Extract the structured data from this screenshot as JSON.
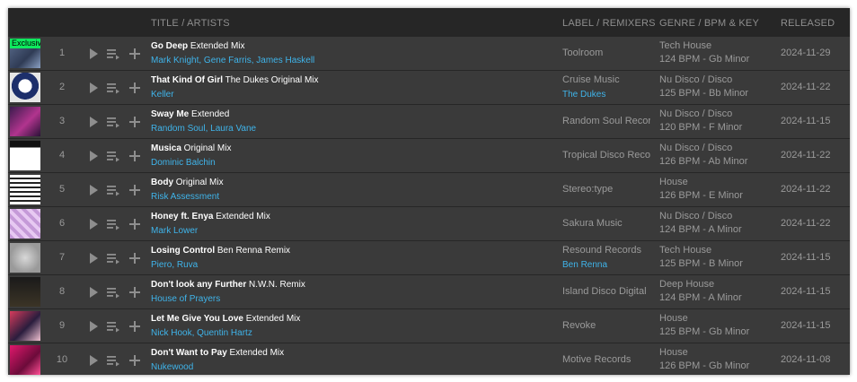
{
  "columns": {
    "title_artists": "TITLE / ARTISTS",
    "label_remixers": "LABEL / REMIXERS",
    "genre_bpm_key": "GENRE / BPM & KEY",
    "released": "RELEASED"
  },
  "badge_exclusive": "Exclusive",
  "icons": [
    "play-icon",
    "add-to-queue-icon",
    "plus-icon"
  ],
  "colors": {
    "accent_blue": "#3fb4ea",
    "exclusive_green": "#0eea5e",
    "row_bg": "#3a3a3a",
    "panel_bg": "#262626"
  },
  "tracks": [
    {
      "num": "1",
      "title": "Go Deep",
      "mix": " Extended Mix",
      "artists": "Mark Knight, Gene Farris, James Haskell",
      "label": "Toolroom",
      "remixers": "",
      "genre": "Tech House",
      "bpm_key": "124 BPM - Gb Minor",
      "released": "2024-11-29",
      "exclusive": true
    },
    {
      "num": "2",
      "title": "That Kind Of Girl",
      "mix": " The Dukes Original Mix",
      "artists": "Keller",
      "label": "Cruise Music",
      "remixers": "The Dukes",
      "genre": "Nu Disco / Disco",
      "bpm_key": "125 BPM - Bb Minor",
      "released": "2024-11-22"
    },
    {
      "num": "3",
      "title": "Sway Me",
      "mix": " Extended",
      "artists": "Random Soul, Laura Vane",
      "label": "Random Soul Recor",
      "remixers": "",
      "genre": "Nu Disco / Disco",
      "bpm_key": "120 BPM - F Minor",
      "released": "2024-11-15"
    },
    {
      "num": "4",
      "title": "Musica",
      "mix": " Original Mix",
      "artists": "Dominic Balchin",
      "label": "Tropical Disco Reco",
      "remixers": "",
      "genre": "Nu Disco / Disco",
      "bpm_key": "126 BPM - Ab Minor",
      "released": "2024-11-22"
    },
    {
      "num": "5",
      "title": "Body",
      "mix": " Original Mix",
      "artists": "Risk Assessment",
      "label": "Stereo:type",
      "remixers": "",
      "genre": "House",
      "bpm_key": "126 BPM - E Minor",
      "released": "2024-11-22"
    },
    {
      "num": "6",
      "title": "Honey ft. Enya",
      "mix": " Extended Mix",
      "artists": "Mark Lower",
      "label": "Sakura Music",
      "remixers": "",
      "genre": "Nu Disco / Disco",
      "bpm_key": "124 BPM - A Minor",
      "released": "2024-11-22"
    },
    {
      "num": "7",
      "title": "Losing Control",
      "mix": " Ben Renna Remix",
      "artists": "Piero, Ruva",
      "label": "Resound Records",
      "remixers": "Ben Renna",
      "genre": "Tech House",
      "bpm_key": "125 BPM - B Minor",
      "released": "2024-11-15"
    },
    {
      "num": "8",
      "title": "Don't look any Further",
      "mix": " N.W.N. Remix",
      "artists": "House of Prayers",
      "label": "Island Disco Digital",
      "remixers": "",
      "genre": "Deep House",
      "bpm_key": "124 BPM - A Minor",
      "released": "2024-11-15"
    },
    {
      "num": "9",
      "title": "Let Me Give You Love",
      "mix": " Extended Mix",
      "artists": "Nick Hook, Quentin Hartz",
      "label": "Revoke",
      "remixers": "",
      "genre": "House",
      "bpm_key": "125 BPM - Gb Minor",
      "released": "2024-11-15"
    },
    {
      "num": "10",
      "title": "Don't Want to Pay",
      "mix": " Extended Mix",
      "artists": "Nukewood",
      "label": "Motive Records",
      "remixers": "",
      "genre": "House",
      "bpm_key": "126 BPM - Gb Minor",
      "released": "2024-11-08"
    }
  ]
}
